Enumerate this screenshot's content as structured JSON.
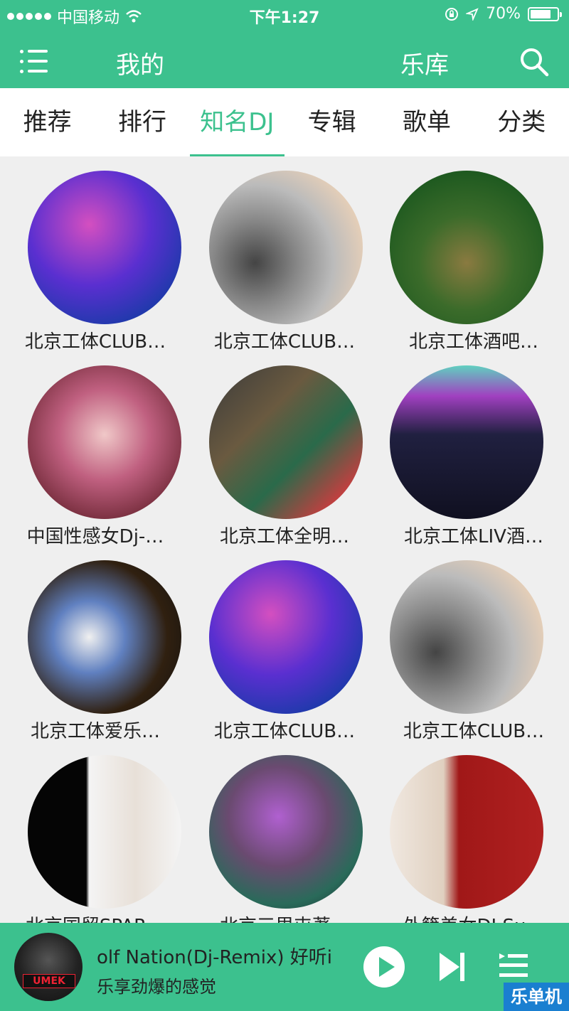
{
  "status_bar": {
    "carrier": "中国移动",
    "time": "下午1:27",
    "battery": "70%"
  },
  "nav": {
    "mine": "我的",
    "library": "乐库"
  },
  "tabs": [
    {
      "label": "推荐"
    },
    {
      "label": "排行"
    },
    {
      "label": "知名DJ",
      "active": true
    },
    {
      "label": "专辑"
    },
    {
      "label": "歌单"
    },
    {
      "label": "分类"
    }
  ],
  "djs": [
    {
      "name": "北京工体CLUB…"
    },
    {
      "name": "北京工体CLUB…"
    },
    {
      "name": "北京工体酒吧…"
    },
    {
      "name": "中国性感女Dj-…"
    },
    {
      "name": "北京工体全明…"
    },
    {
      "name": "北京工体LIV酒…"
    },
    {
      "name": "北京工体爱乐…"
    },
    {
      "name": "北京工体CLUB…"
    },
    {
      "name": "北京工体CLUB…"
    },
    {
      "name": "北京国贸SPAR…"
    },
    {
      "name": "北京三里屯著…"
    },
    {
      "name": "外籍美女DJ Su…"
    }
  ],
  "player": {
    "track_title": "olf Nation(Dj-Remix)  好听i",
    "track_sub": "乐享劲爆的感觉",
    "album_logo": "UMEK"
  },
  "watermark": "乐单机",
  "colors": {
    "accent": "#3cc18e",
    "background": "#efefef"
  },
  "icons": {
    "menu": "menu-icon",
    "search": "search-icon",
    "play": "play-icon",
    "next": "next-icon",
    "queue": "queue-icon"
  }
}
